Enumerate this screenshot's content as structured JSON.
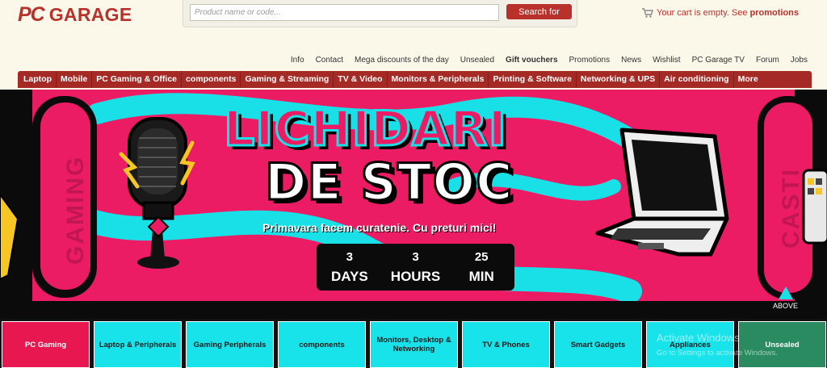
{
  "brand": {
    "logo_pc": "PC",
    "logo_text": "GARAGE",
    "color": "#b8322b"
  },
  "search": {
    "placeholder": "Product name or code...",
    "button_label": "Search for"
  },
  "cart": {
    "text": "Your cart is empty. See",
    "promo_link": "promotions"
  },
  "top_links": [
    "Info",
    "Contact",
    "Mega discounts of the day",
    "Unsealed",
    "Gift vouchers",
    "Promotions",
    "News",
    "Wishlist",
    "PC Garage TV",
    "Forum",
    "Jobs"
  ],
  "categories": [
    "Laptop",
    "Mobile",
    "PC Gaming & Office",
    "components",
    "Gaming & Streaming",
    "TV & Video",
    "Monitors & Peripherals",
    "Printing & Software",
    "Networking & UPS",
    "Air conditioning",
    "More"
  ],
  "banner": {
    "headline_1": "LICHIDARI",
    "headline_2": "DE STOC",
    "tagline": "Primavara facem curatenie. Cu preturi mici!",
    "side_left": "GAMING",
    "side_right": "CASTI",
    "countdown": [
      {
        "value": "3",
        "label": "DAYS"
      },
      {
        "value": "3",
        "label": "HOURS"
      },
      {
        "value": "25",
        "label": "MIN"
      }
    ],
    "above_label": "ABOVE",
    "colors": {
      "pink": "#ec1c64",
      "cyan": "#19e0e6",
      "black": "#0b0b0b"
    }
  },
  "tiles": [
    "PC Gaming",
    "Laptop & Peripherals",
    "Gaming Peripherals",
    "components",
    "Monitors, Desktop & Networking",
    "TV & Phones",
    "Smart Gadgets",
    "Appliances",
    "Unsealed"
  ],
  "watermark": {
    "title": "Activate Windows",
    "subtitle": "Go to Settings to activate Windows."
  }
}
